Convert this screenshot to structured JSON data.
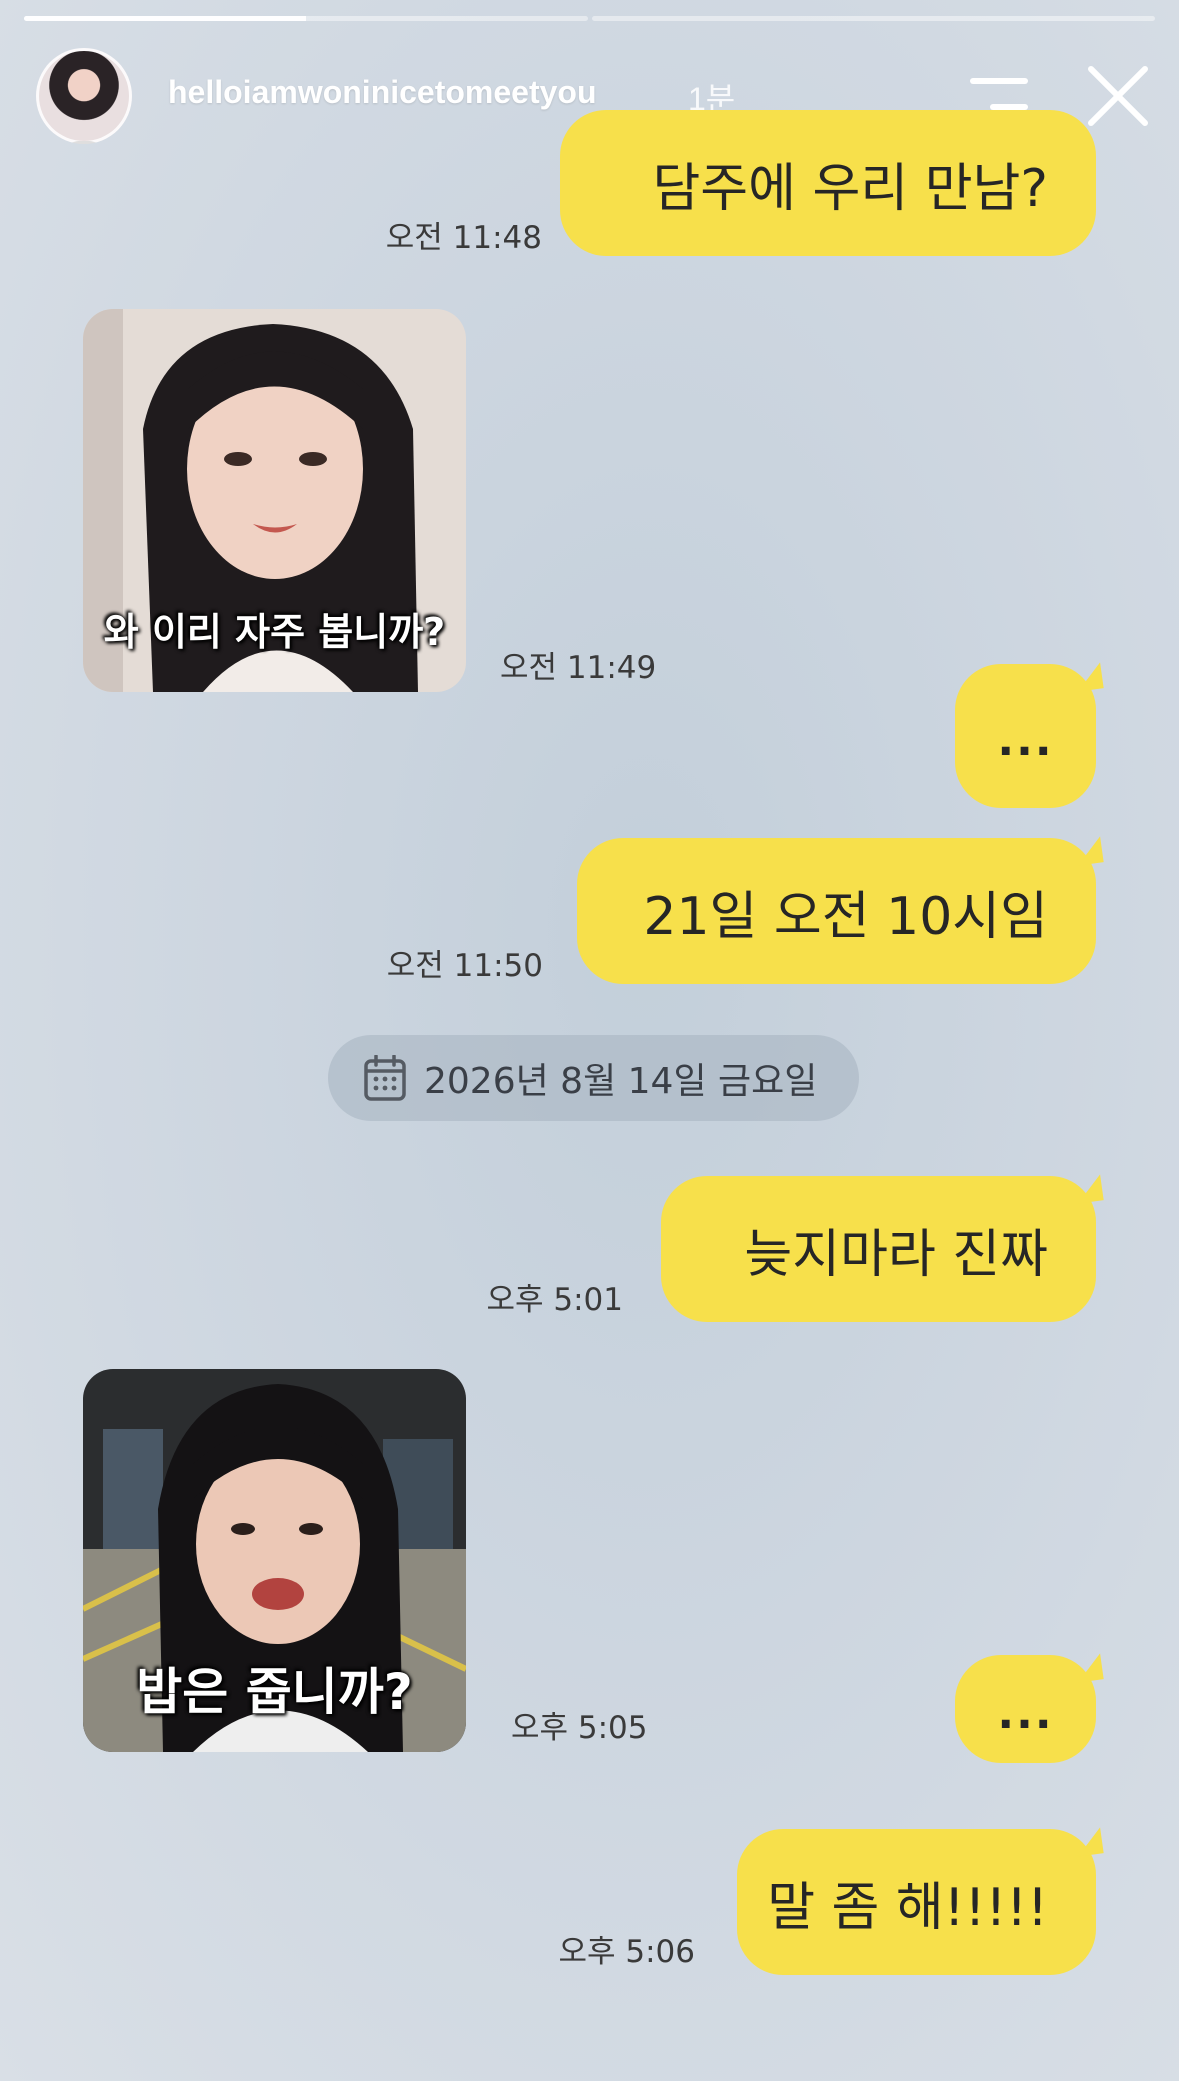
{
  "story": {
    "progress": [
      0.5,
      0
    ],
    "username": "helloiamwoninicetomeetyou",
    "time_ago": "1분",
    "menu_icon": "menu-icon",
    "close_icon": "close-icon"
  },
  "messages": {
    "m1": {
      "text": "담주에 우리 만남?",
      "time": "오전 11:48"
    },
    "m2": {
      "caption": "와 이리 자주 봅니까?",
      "time": "오전 11:49"
    },
    "m3": {
      "text": "...",
      "time": ""
    },
    "m4": {
      "text": "21일 오전 10시임",
      "time": "오전 11:50"
    },
    "m5": {
      "text": "늦지마라 진짜",
      "time": "오후 5:01"
    },
    "m6": {
      "caption": "밥은 줍니까?",
      "time": "오후 5:05"
    },
    "m7": {
      "text": "...",
      "time": ""
    },
    "m8": {
      "text": "말 좀 해!!!!!",
      "time": "오후 5:06"
    }
  },
  "date_divider": {
    "icon": "calendar-icon",
    "text": "2026년 8월 14일 금요일"
  },
  "colors": {
    "bubble": "#f7e04b",
    "background": "#cdd6e0",
    "date_pill": "#a5b2c0"
  }
}
